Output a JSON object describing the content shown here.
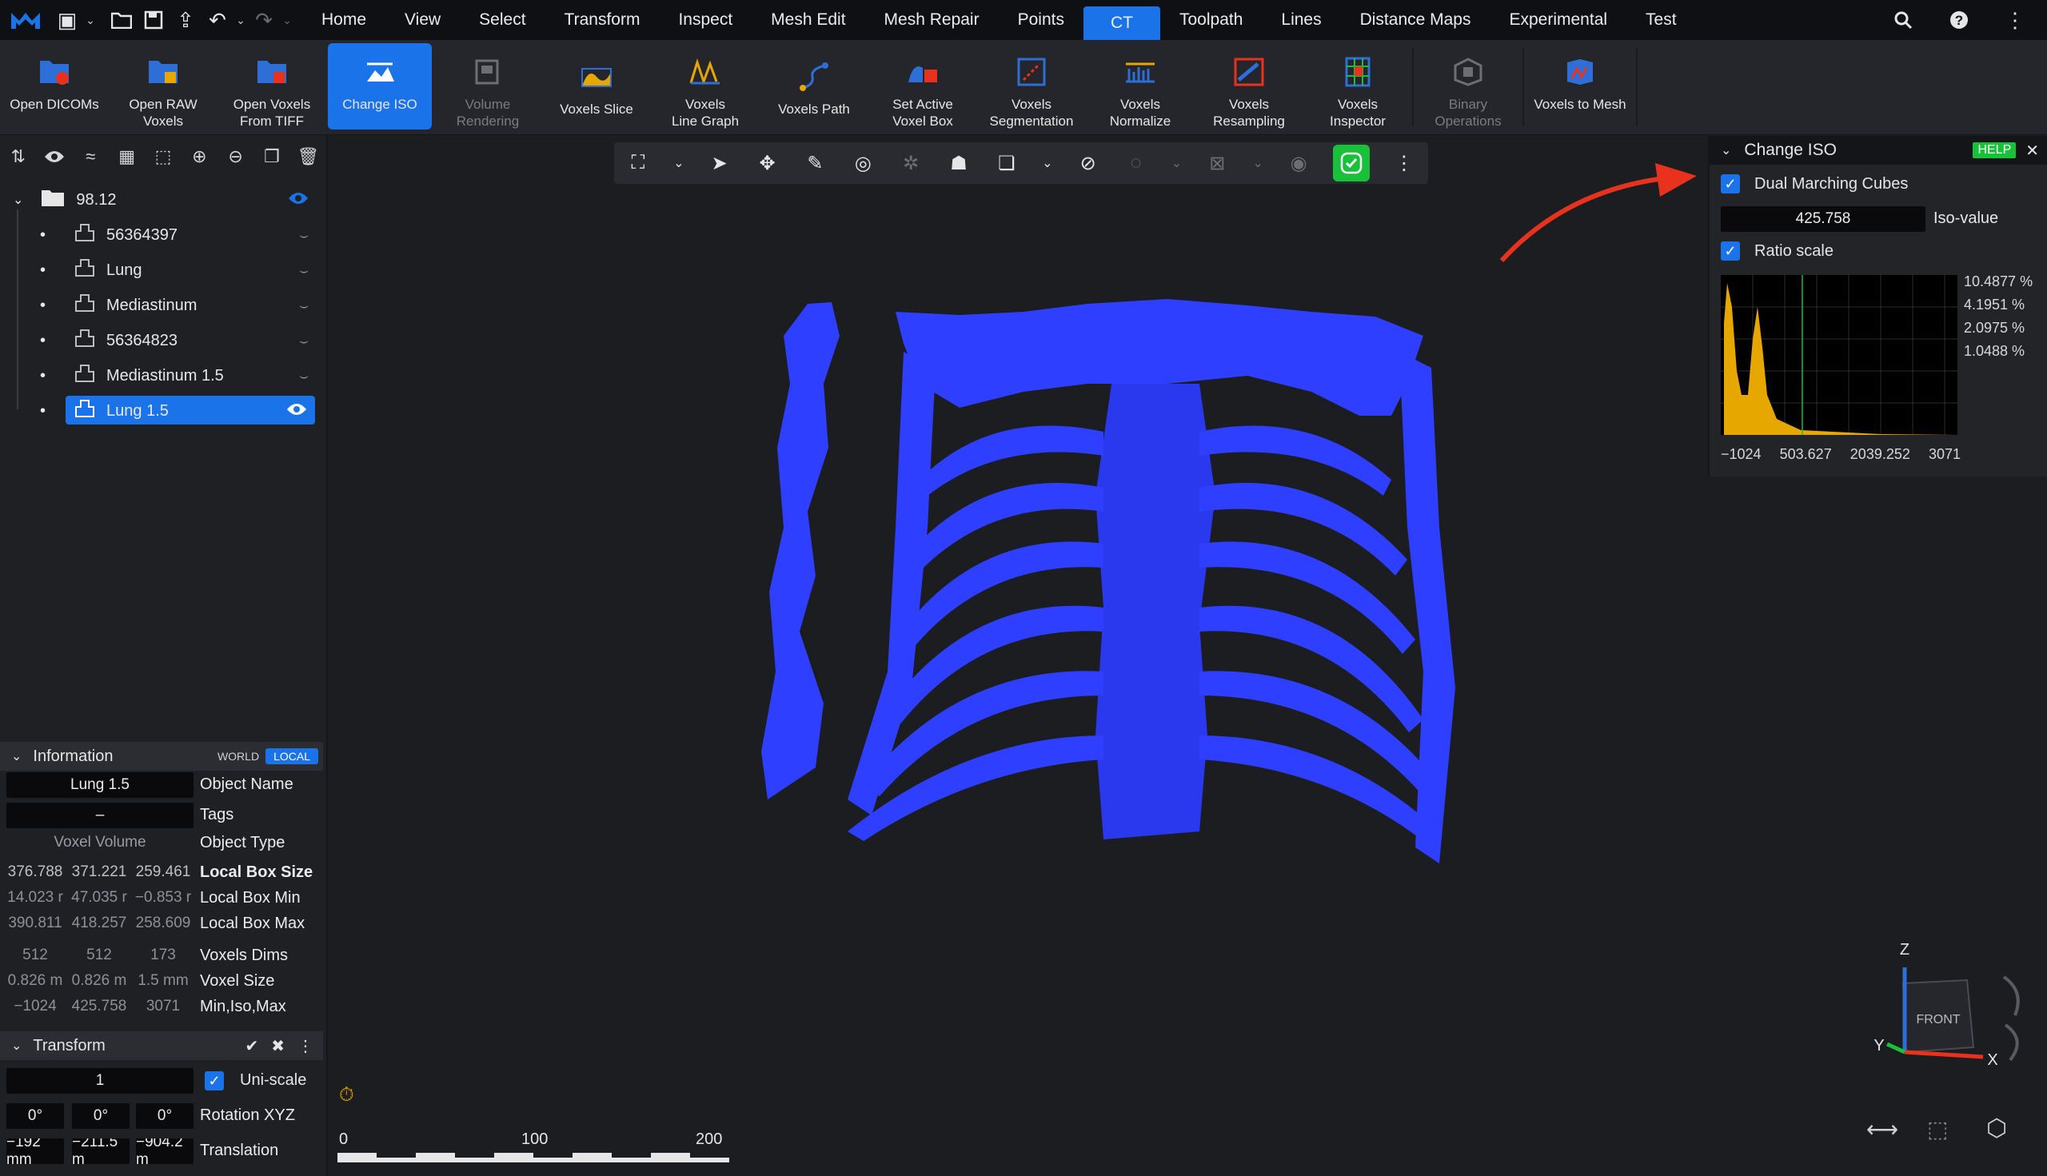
{
  "menubar": {
    "items": [
      "Home",
      "View",
      "Select",
      "Transform",
      "Inspect",
      "Mesh Edit",
      "Mesh Repair",
      "Points",
      "CT",
      "Toolpath",
      "Lines",
      "Distance Maps",
      "Experimental",
      "Test"
    ],
    "active": "CT"
  },
  "ribbon": {
    "buttons": [
      {
        "label": "Open DICOMs",
        "icon": "dicom-folder-icon",
        "state": "normal"
      },
      {
        "label": "Open RAW\nVoxels",
        "icon": "raw-folder-icon",
        "state": "normal"
      },
      {
        "label": "Open Voxels\nFrom TIFF",
        "icon": "tiff-folder-icon",
        "state": "normal"
      },
      {
        "label": "Change ISO",
        "icon": "iso-surface-icon",
        "state": "active"
      },
      {
        "label": "Volume\nRendering",
        "icon": "volume-rendering-icon",
        "state": "disabled"
      },
      {
        "label": "Voxels Slice",
        "icon": "voxels-slice-icon",
        "state": "normal"
      },
      {
        "label": "Voxels\nLine Graph",
        "icon": "line-graph-icon",
        "state": "normal"
      },
      {
        "label": "Voxels Path",
        "icon": "voxels-path-icon",
        "state": "normal"
      },
      {
        "label": "Set Active\nVoxel Box",
        "icon": "voxel-box-icon",
        "state": "normal"
      },
      {
        "label": "Voxels\nSegmentation",
        "icon": "segmentation-icon",
        "state": "normal"
      },
      {
        "label": "Voxels\nNormalize",
        "icon": "normalize-icon",
        "state": "normal"
      },
      {
        "label": "Voxels\nResampling",
        "icon": "resampling-icon",
        "state": "normal"
      },
      {
        "label": "Voxels\nInspector",
        "icon": "inspector-icon",
        "state": "normal"
      },
      {
        "label": "Binary\nOperations",
        "icon": "binary-operations-icon",
        "state": "disabled"
      },
      {
        "label": "Voxels to Mesh",
        "icon": "voxels-to-mesh-icon",
        "state": "normal"
      }
    ]
  },
  "scene": {
    "root": "98.12",
    "items": [
      {
        "name": "56364397",
        "selected": false
      },
      {
        "name": "Lung",
        "selected": false
      },
      {
        "name": "Mediastinum",
        "selected": false
      },
      {
        "name": "56364823",
        "selected": false
      },
      {
        "name": "Mediastinum 1.5",
        "selected": false
      },
      {
        "name": "Lung 1.5",
        "selected": true
      }
    ]
  },
  "information": {
    "title": "Information",
    "world": "WORLD",
    "local": "LOCAL",
    "object_name": "Lung 1.5",
    "object_name_label": "Object Name",
    "tags": "–",
    "tags_label": "Tags",
    "object_type": "Voxel Volume",
    "object_type_label": "Object Type",
    "box_size": [
      "376.788",
      "371.221",
      "259.461"
    ],
    "box_size_label": "Local Box Size",
    "box_min": [
      "14.023 r",
      "47.035 r",
      "−0.853 r"
    ],
    "box_min_label": "Local Box Min",
    "box_max": [
      "390.811",
      "418.257",
      "258.609"
    ],
    "box_max_label": "Local Box Max",
    "dims": [
      "512",
      "512",
      "173"
    ],
    "dims_label": "Voxels Dims",
    "voxel_size": [
      "0.826 m",
      "0.826 m",
      "1.5 mm"
    ],
    "voxel_size_label": "Voxel Size",
    "min_iso_max": [
      "−1024",
      "425.758",
      "3071"
    ],
    "min_iso_max_label": "Min,Iso,Max"
  },
  "transform": {
    "title": "Transform",
    "scale": "1",
    "uniscale_label": "Uni-scale",
    "rotation": [
      "0°",
      "0°",
      "0°"
    ],
    "rotation_label": "Rotation XYZ",
    "translation": [
      "−192 mm",
      "−211.5 m",
      "−904.2 m"
    ],
    "translation_label": "Translation"
  },
  "change_iso": {
    "title": "Change ISO",
    "help": "HELP",
    "dual_marching_cubes_label": "Dual Marching Cubes",
    "dual_marching_cubes": true,
    "iso_value": "425.758",
    "iso_value_label": "Iso-value",
    "ratio_scale_label": "Ratio scale",
    "ratio_scale": true,
    "hist_y_labels": [
      "10.4877 %",
      "4.1951 %",
      "2.0975 %",
      "1.0488 %"
    ],
    "hist_x_labels": [
      "−1024",
      "503.627",
      "2039.252",
      "3071"
    ]
  },
  "scalebar": {
    "labels": [
      "0",
      "100",
      "200"
    ]
  },
  "axes": {
    "z": "Z",
    "y": "Y",
    "x": "X",
    "face": "FRONT"
  },
  "colors": {
    "accent": "#1a73e8",
    "mesh": "#2f3fff",
    "green": "#19c03a",
    "arrow": "#e8321e",
    "hist": "#e6a800"
  }
}
